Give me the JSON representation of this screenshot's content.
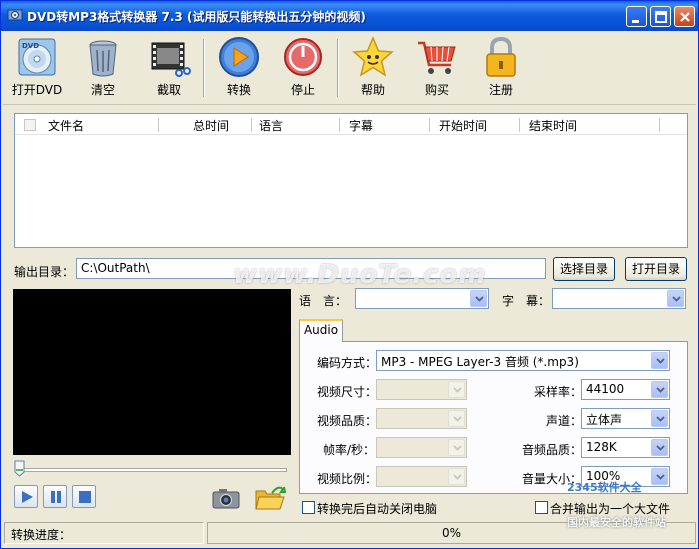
{
  "window": {
    "title": "DVD转MP3格式转换器 7.3 (试用版只能转换出五分钟的视频)"
  },
  "toolbar": {
    "items": [
      {
        "id": "open-dvd",
        "label": "打开DVD",
        "icon": "dvd-disc-icon"
      },
      {
        "id": "clear",
        "label": "清空",
        "icon": "trash-can-icon"
      },
      {
        "id": "clip",
        "label": "截取",
        "icon": "film-scissors-icon"
      },
      {
        "id": "convert",
        "label": "转换",
        "icon": "play-circle-icon"
      },
      {
        "id": "stop",
        "label": "停止",
        "icon": "power-stop-icon"
      },
      {
        "id": "help",
        "label": "帮助",
        "icon": "star-face-icon"
      },
      {
        "id": "buy",
        "label": "购买",
        "icon": "shopping-cart-icon"
      },
      {
        "id": "register",
        "label": "注册",
        "icon": "padlock-icon"
      }
    ]
  },
  "file_list": {
    "columns": [
      "文件名",
      "总时间",
      "语言",
      "字幕",
      "开始时间",
      "结束时间"
    ],
    "rows": []
  },
  "output": {
    "label": "输出目录：",
    "path": "C:\\OutPath\\",
    "choose_label": "选择目录",
    "open_label": "打开目录"
  },
  "language": {
    "label": "语　言：",
    "value": ""
  },
  "subtitle": {
    "label": "字　幕：",
    "value": ""
  },
  "tab": {
    "label": "Audio"
  },
  "settings": {
    "codec_label": "编码方式：",
    "codec_value": "MP3 - MPEG Layer-3 音频 (*.mp3)",
    "video_size_label": "视频尺寸：",
    "video_quality_label": "视频品质：",
    "frame_rate_label": "帧率/秒：",
    "aspect_label": "视频比例：",
    "sample_rate_label": "采样率：",
    "sample_rate_value": "44100",
    "channel_label": "声道：",
    "channel_value": "立体声",
    "audio_quality_label": "音频品质：",
    "audio_quality_value": "128K",
    "volume_label": "音量大小：",
    "volume_value": "100%"
  },
  "options": {
    "shutdown_label": "转换完后自动关闭电脑",
    "shutdown_checked": false,
    "merge_label": "合并输出为一个大文件",
    "merge_checked": false
  },
  "status": {
    "progress_label": "转换进度：",
    "progress_text": "0%",
    "progress_fraction": 0
  },
  "watermarks": {
    "site": "www.DuoTe.com",
    "badge_top": "2345软件大全",
    "badge_bottom": "国内最安全的软件站"
  },
  "colors": {
    "titlebar": "#0752d6",
    "window_bg": "#ece9d8",
    "preview_bg": "#000000",
    "tab_highlight": "#ffc83c"
  }
}
